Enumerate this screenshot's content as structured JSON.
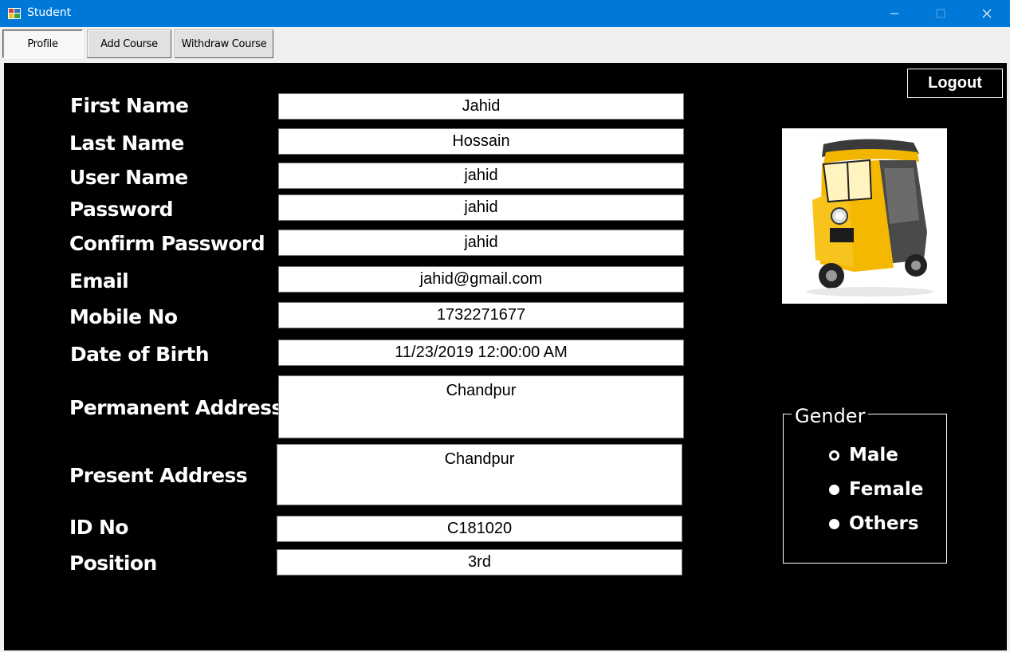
{
  "window": {
    "title": "Student"
  },
  "tabs": [
    {
      "label": "Profile",
      "active": true
    },
    {
      "label": "Add Course",
      "active": false
    },
    {
      "label": "Withdraw Course",
      "active": false
    }
  ],
  "logout_label": "Logout",
  "form": {
    "first_name": {
      "label": "First Name",
      "value": "Jahid"
    },
    "last_name": {
      "label": "Last Name",
      "value": "Hossain"
    },
    "user_name": {
      "label": "User Name",
      "value": "jahid"
    },
    "password": {
      "label": "Password",
      "value": "jahid"
    },
    "confirm_password": {
      "label": "Confirm Password",
      "value": "jahid"
    },
    "email": {
      "label": "Email",
      "value": "jahid@gmail.com"
    },
    "mobile": {
      "label": "Mobile No",
      "value": "1732271677"
    },
    "dob": {
      "label": "Date of Birth",
      "value": "11/23/2019 12:00:00 AM"
    },
    "permanent_address": {
      "label": "Permanent Address",
      "value": "Chandpur"
    },
    "present_address": {
      "label": "Present Address",
      "value": "Chandpur"
    },
    "id_no": {
      "label": "ID No",
      "value": "C181020"
    },
    "position": {
      "label": "Position",
      "value": "3rd"
    }
  },
  "gender": {
    "title": "Gender",
    "options": [
      {
        "label": "Male",
        "selected": false
      },
      {
        "label": "Female",
        "selected": true
      },
      {
        "label": "Others",
        "selected": true
      }
    ]
  },
  "photo": {
    "icon": "auto-rickshaw-image"
  }
}
